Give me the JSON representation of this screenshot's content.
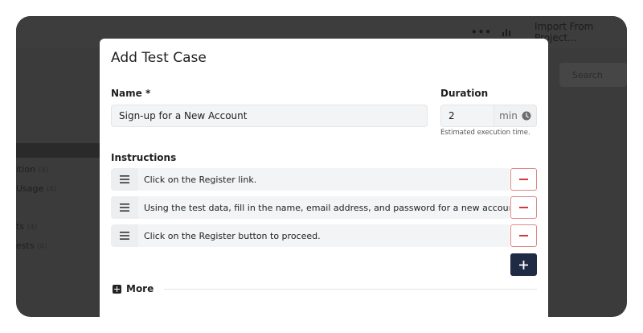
{
  "background": {
    "toolbar": {
      "more_label": "•••",
      "import_label": "Import From Project..."
    },
    "search_placeholder": "Search",
    "sidebar_items": [
      {
        "label": "ition",
        "count": "(4)"
      },
      {
        "label": "Usage",
        "count": "(4)"
      },
      {
        "label": "ts",
        "count": "(4)"
      },
      {
        "label": "ests",
        "count": "(4)"
      }
    ]
  },
  "modal": {
    "title": "Add Test Case",
    "name": {
      "label": "Name *",
      "value": "Sign-up for a New Account"
    },
    "duration": {
      "label": "Duration",
      "value": "2",
      "unit": "min",
      "hint": "Estimated execution time."
    },
    "instructions": {
      "label": "Instructions",
      "steps": [
        "Click on the Register link.",
        "Using the test data, fill in the name, email address, and password for a new account.",
        "Click on the Register button to proceed."
      ]
    },
    "more_label": "More"
  },
  "colors": {
    "primary": "#1f2b45",
    "danger": "#d23b3b",
    "overlay": "#3b3b3c"
  }
}
